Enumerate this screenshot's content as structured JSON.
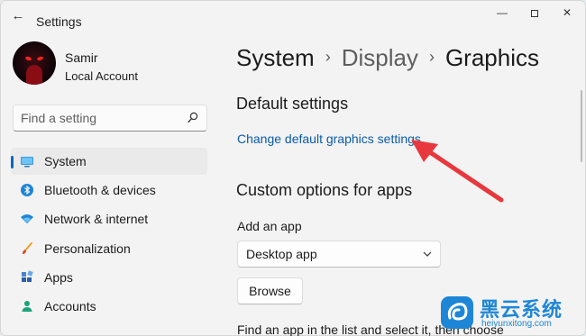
{
  "window": {
    "title": "Settings",
    "back_icon": "arrow-left-icon",
    "controls": [
      "minimize-icon",
      "maximize-icon",
      "close-icon"
    ]
  },
  "user": {
    "name": "Samir",
    "account_type": "Local Account"
  },
  "search": {
    "placeholder": "Find a setting",
    "icon": "search-icon"
  },
  "sidebar": {
    "items": [
      {
        "label": "System",
        "icon": "monitor-icon",
        "selected": true
      },
      {
        "label": "Bluetooth & devices",
        "icon": "bluetooth-icon",
        "selected": false
      },
      {
        "label": "Network & internet",
        "icon": "wifi-icon",
        "selected": false
      },
      {
        "label": "Personalization",
        "icon": "brush-icon",
        "selected": false
      },
      {
        "label": "Apps",
        "icon": "apps-icon",
        "selected": false
      },
      {
        "label": "Accounts",
        "icon": "person-icon",
        "selected": false
      }
    ]
  },
  "breadcrumb": {
    "items": [
      "System",
      "Display",
      "Graphics"
    ],
    "separator": "›"
  },
  "main": {
    "default_section_title": "Default settings",
    "default_link": "Change default graphics settings",
    "custom_section_title": "Custom options for apps",
    "add_app_label": "Add an app",
    "app_type_selected": "Desktop app",
    "browse_label": "Browse",
    "hint_text": "Find an app in the list and select it, then choose"
  },
  "watermark": {
    "text": "黑云系统",
    "url": "heiyunxitong.com"
  },
  "colors": {
    "accent": "#0067c0",
    "link": "#0a5aa8",
    "annotation_arrow": "#e8383d",
    "watermark": "#1e86d6"
  }
}
